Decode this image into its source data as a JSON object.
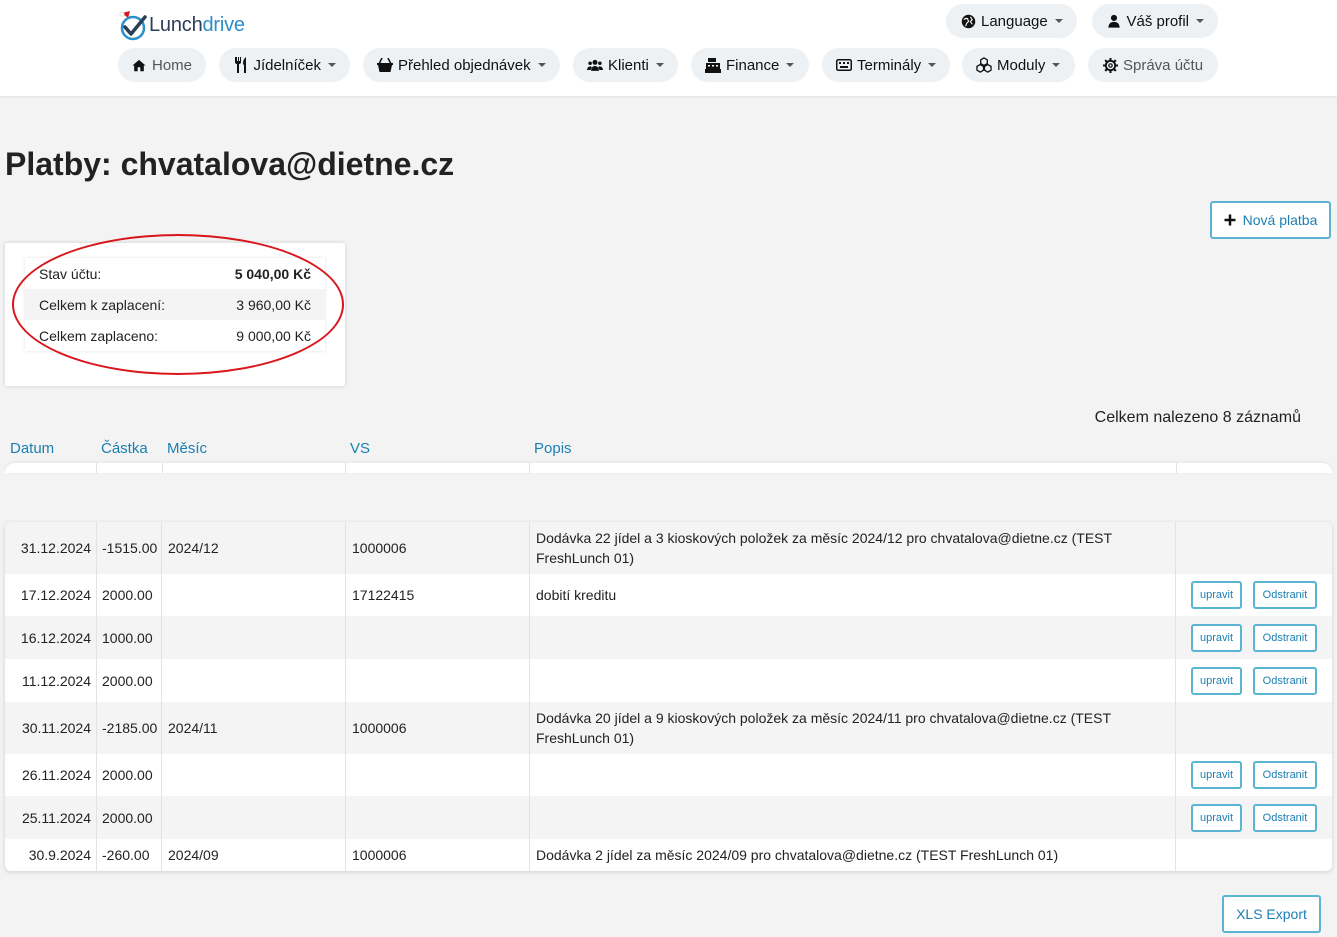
{
  "brand": {
    "name_part1": "Lunch",
    "name_part2": "drive"
  },
  "nav": {
    "language": "Language",
    "profile": "Váš profil",
    "home": "Home",
    "menu": "Jídelníček",
    "orders": "Přehled objednávek",
    "clients": "Klienti",
    "finance": "Finance",
    "terminals": "Terminály",
    "modules": "Moduly",
    "account": "Správa účtu"
  },
  "page": {
    "title": "Platby: chvatalova@dietne.cz",
    "new_payment": "Nová platba",
    "records_found": "Celkem nalezeno 8 záznamů",
    "export": "XLS Export"
  },
  "summary": [
    {
      "label": "Stav účtu:",
      "value": "5 040,00 Kč"
    },
    {
      "label": "Celkem k zaplacení:",
      "value": "3 960,00 Kč"
    },
    {
      "label": "Celkem zaplaceno:",
      "value": "9 000,00 Kč"
    }
  ],
  "table": {
    "headers": [
      "Datum",
      "Částka",
      "Měsíc",
      "VS",
      "Popis"
    ],
    "edit_label": "upravit",
    "delete_label": "Odstranit",
    "rows": [
      {
        "date": "31.12.2024",
        "amount": "-1515.00",
        "month": "2024/12",
        "vs": "1000006",
        "desc": "Dodávka 22 jídel a 3 kioskových položek za měsíc 2024/12 pro chvatalova@dietne.cz (TEST FreshLunch 01)",
        "actions": false
      },
      {
        "date": "17.12.2024",
        "amount": "2000.00",
        "month": "",
        "vs": "17122415",
        "desc": "dobití kreditu",
        "actions": true
      },
      {
        "date": "16.12.2024",
        "amount": "1000.00",
        "month": "",
        "vs": "",
        "desc": "",
        "actions": true
      },
      {
        "date": "11.12.2024",
        "amount": "2000.00",
        "month": "",
        "vs": "",
        "desc": "",
        "actions": true
      },
      {
        "date": "30.11.2024",
        "amount": "-2185.00",
        "month": "2024/11",
        "vs": "1000006",
        "desc": "Dodávka 20 jídel a 9 kioskových položek za měsíc 2024/11 pro chvatalova@dietne.cz (TEST FreshLunch 01)",
        "actions": false
      },
      {
        "date": "26.11.2024",
        "amount": "2000.00",
        "month": "",
        "vs": "",
        "desc": "",
        "actions": true
      },
      {
        "date": "25.11.2024",
        "amount": "2000.00",
        "month": "",
        "vs": "",
        "desc": "",
        "actions": true
      },
      {
        "date": "30.9.2024",
        "amount": "-260.00",
        "month": "2024/09",
        "vs": "1000006",
        "desc": "Dodávka 2 jídel za měsíc 2024/09 pro chvatalova@dietne.cz (TEST FreshLunch 01)",
        "actions": false
      }
    ]
  },
  "colors": {
    "accent": "#1b7fb2",
    "button_border": "#5ab4d6",
    "highlight_circle": "#d9161c"
  },
  "icons": [
    "globe-icon",
    "user-icon",
    "home-icon",
    "cutlery-icon",
    "basket-icon",
    "users-icon",
    "cash-register-icon",
    "keyboard-icon",
    "cubes-icon",
    "gear-icon",
    "plus-icon",
    "caret-down-icon"
  ]
}
